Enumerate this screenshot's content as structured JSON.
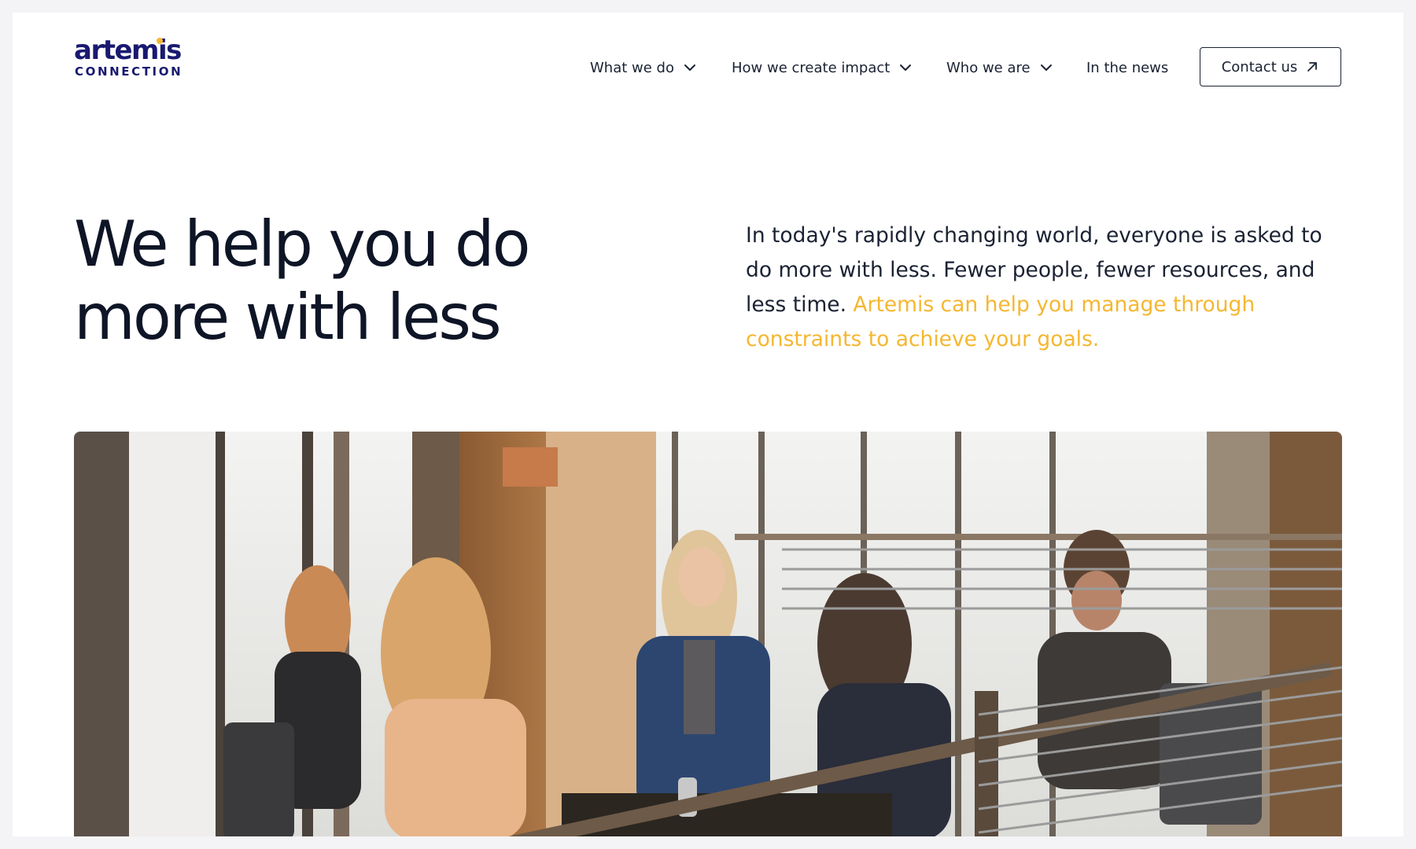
{
  "brand": {
    "logo_word": "artemis",
    "logo_sub": "CONNECTION",
    "accent_color": "#f5b731",
    "brand_color": "#191970"
  },
  "nav": {
    "items": [
      {
        "label": "What we do",
        "has_dropdown": true
      },
      {
        "label": "How we create impact",
        "has_dropdown": true
      },
      {
        "label": "Who we are",
        "has_dropdown": true
      },
      {
        "label": "In the news",
        "has_dropdown": false
      }
    ],
    "contact_label": "Contact us"
  },
  "hero": {
    "title_line1": "We help you do",
    "title_line2": "more with less",
    "body_plain": "In today's rapidly changing world, everyone is asked to do more with less. Fewer people, fewer resources, and less time. ",
    "body_accent": "Artemis can help you manage through constraints to achieve your goals."
  },
  "photo": {
    "icon": "team-meeting-photo"
  }
}
